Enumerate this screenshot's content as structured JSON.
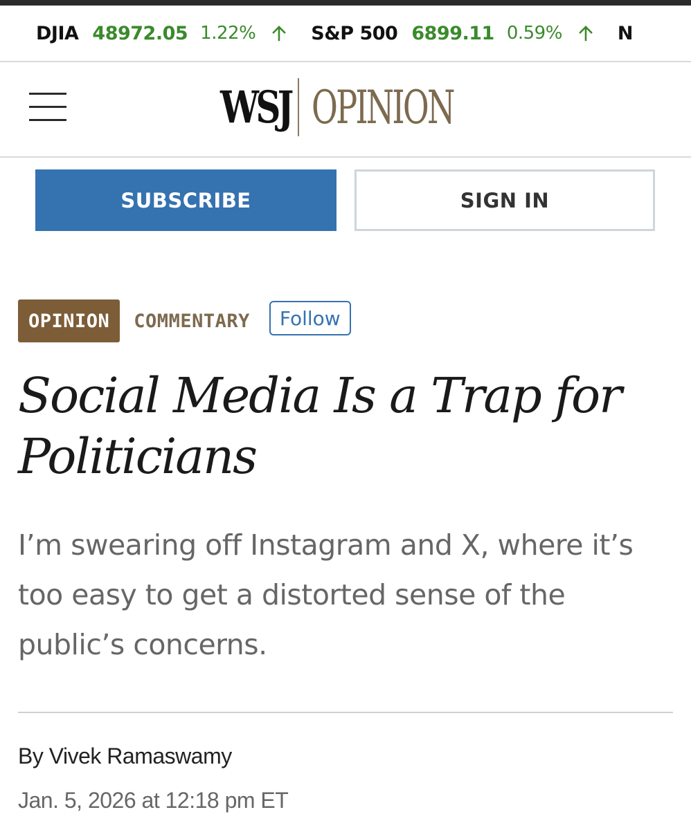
{
  "ticker": {
    "items": [
      {
        "symbol": "DJIA",
        "value": "48972.05",
        "change": "1.22%",
        "direction": "up"
      },
      {
        "symbol": "S&P 500",
        "value": "6899.11",
        "change": "0.59%",
        "direction": "up"
      },
      {
        "symbol": "N",
        "value": "",
        "change": "",
        "direction": ""
      }
    ],
    "up_color": "#3a8a2c"
  },
  "masthead": {
    "logo_primary": "WSJ",
    "logo_section": "OPINION",
    "menu_icon": "hamburger-menu-icon"
  },
  "auth": {
    "subscribe_label": "SUBSCRIBE",
    "signin_label": "SIGN IN"
  },
  "article": {
    "section_badge": "OPINION",
    "category": "COMMENTARY",
    "follow_label": "Follow",
    "headline": "Social Media Is a Trap for Politicians",
    "dek": "I’m swearing off Instagram and X, where it’s too easy to get a distorted sense of the public’s concerns.",
    "byline_prefix": "By",
    "author": "Vivek Ramaswamy",
    "timestamp": "Jan. 5, 2026 at 12:18 pm ET"
  },
  "colors": {
    "subscribe_bg": "#3572b0",
    "opinion_badge_bg": "#7d5d37",
    "opinion_text": "#7d6a4f"
  }
}
